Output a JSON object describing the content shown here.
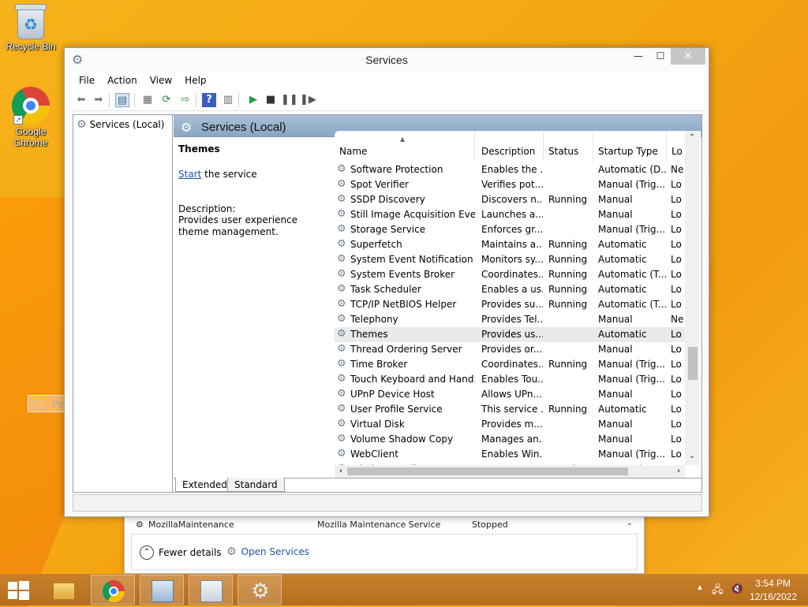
{
  "desktop": {
    "icons": [
      {
        "label": "Recycle Bin"
      },
      {
        "label": "Google\nChrome"
      }
    ]
  },
  "window": {
    "title": "Services",
    "menu": [
      "File",
      "Action",
      "View",
      "Help"
    ]
  },
  "tree": {
    "root": "Services (Local)"
  },
  "pane": {
    "header": "Services (Local)",
    "selected_name": "Themes",
    "action_link": "Start",
    "action_suffix": " the service",
    "description_label": "Description:",
    "description": "Provides user experience theme management."
  },
  "columns": [
    "Name",
    "Description",
    "Status",
    "Startup Type",
    "Lo"
  ],
  "rows": [
    {
      "name": "Software Protection",
      "desc": "Enables the ...",
      "status": "",
      "startup": "Automatic (D...",
      "logon": "Ne"
    },
    {
      "name": "Spot Verifier",
      "desc": "Verifies pot...",
      "status": "",
      "startup": "Manual (Trig...",
      "logon": "Lo"
    },
    {
      "name": "SSDP Discovery",
      "desc": "Discovers n...",
      "status": "Running",
      "startup": "Manual",
      "logon": "Lo"
    },
    {
      "name": "Still Image Acquisition Events",
      "desc": "Launches a...",
      "status": "",
      "startup": "Manual",
      "logon": "Lo"
    },
    {
      "name": "Storage Service",
      "desc": "Enforces gr...",
      "status": "",
      "startup": "Manual (Trig...",
      "logon": "Lo"
    },
    {
      "name": "Superfetch",
      "desc": "Maintains a...",
      "status": "Running",
      "startup": "Automatic",
      "logon": "Lo"
    },
    {
      "name": "System Event Notification S...",
      "desc": "Monitors sy...",
      "status": "Running",
      "startup": "Automatic",
      "logon": "Lo"
    },
    {
      "name": "System Events Broker",
      "desc": "Coordinates...",
      "status": "Running",
      "startup": "Automatic (T...",
      "logon": "Lo"
    },
    {
      "name": "Task Scheduler",
      "desc": "Enables a us...",
      "status": "Running",
      "startup": "Automatic",
      "logon": "Lo"
    },
    {
      "name": "TCP/IP NetBIOS Helper",
      "desc": "Provides su...",
      "status": "Running",
      "startup": "Automatic (T...",
      "logon": "Lo"
    },
    {
      "name": "Telephony",
      "desc": "Provides Tel...",
      "status": "",
      "startup": "Manual",
      "logon": "Ne"
    },
    {
      "name": "Themes",
      "desc": "Provides us...",
      "status": "",
      "startup": "Automatic",
      "logon": "Lo",
      "selected": true
    },
    {
      "name": "Thread Ordering Server",
      "desc": "Provides or...",
      "status": "",
      "startup": "Manual",
      "logon": "Lo"
    },
    {
      "name": "Time Broker",
      "desc": "Coordinates...",
      "status": "Running",
      "startup": "Manual (Trig...",
      "logon": "Lo"
    },
    {
      "name": "Touch Keyboard and Hand...",
      "desc": "Enables Tou...",
      "status": "",
      "startup": "Manual (Trig...",
      "logon": "Lo"
    },
    {
      "name": "UPnP Device Host",
      "desc": "Allows UPn...",
      "status": "",
      "startup": "Manual",
      "logon": "Lo"
    },
    {
      "name": "User Profile Service",
      "desc": "This service ...",
      "status": "Running",
      "startup": "Automatic",
      "logon": "Lo"
    },
    {
      "name": "Virtual Disk",
      "desc": "Provides m...",
      "status": "",
      "startup": "Manual",
      "logon": "Lo"
    },
    {
      "name": "Volume Shadow Copy",
      "desc": "Manages an...",
      "status": "",
      "startup": "Manual",
      "logon": "Lo"
    },
    {
      "name": "WebClient",
      "desc": "Enables Win...",
      "status": "",
      "startup": "Manual (Trig...",
      "logon": "Lo"
    },
    {
      "name": "Windows Audio",
      "desc": "Manages au...",
      "status": "Running",
      "startup": "Automatic",
      "logon": "Lo"
    }
  ],
  "tabs": [
    "Extended",
    "Standard"
  ],
  "ghost_menu": {
    "label": "Personalize"
  },
  "task_manager": {
    "row": {
      "name": "MozillaMaintenance",
      "desc": "Mozilla Maintenance Service",
      "status": "Stopped"
    },
    "fewer_details": "Fewer details",
    "open_services": "Open Services"
  },
  "tray": {
    "time": "3:54 PM",
    "date": "12/16/2022"
  },
  "colors": {
    "accent_header": "#8aa6c2",
    "taskbar": "#b56d1f",
    "desktop": "#f5a814",
    "link": "#1a56a8"
  }
}
